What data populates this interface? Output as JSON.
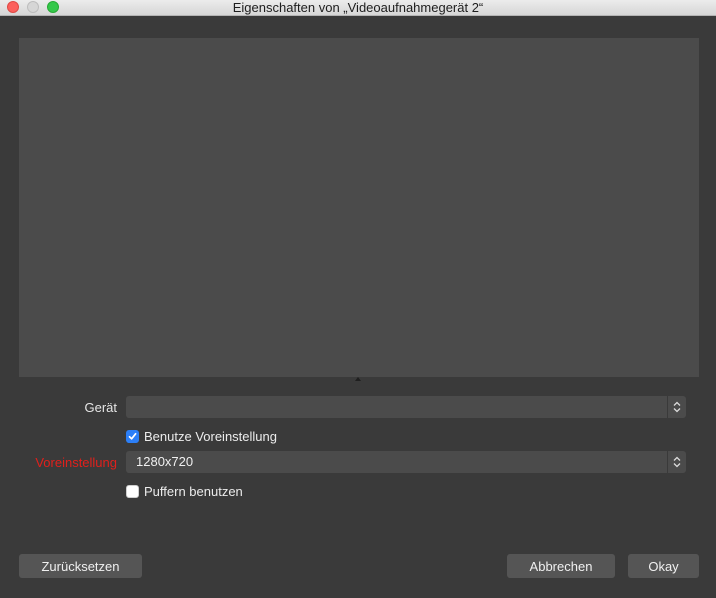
{
  "window": {
    "title": "Eigenschaften von „Videoaufnahmegerät 2“"
  },
  "form": {
    "device": {
      "label": "Gerät",
      "value": ""
    },
    "use_preset": {
      "label": "Benutze Voreinstellung",
      "checked": true
    },
    "preset": {
      "label": "Voreinstellung",
      "value": "1280x720",
      "label_color": "#e0201c"
    },
    "buffering": {
      "label": "Puffern benutzen",
      "checked": false
    }
  },
  "buttons": {
    "reset": "Zurücksetzen",
    "cancel": "Abbrechen",
    "ok": "Okay"
  },
  "icons": {
    "close": "close-icon",
    "minimize": "minimize-icon",
    "maximize": "maximize-icon",
    "combo_arrows": "chevron-up-down-icon",
    "check": "checkmark-icon"
  },
  "colors": {
    "accent": "#2c7ff7",
    "background": "#3a3a3a",
    "preview": "#4b4b4b"
  }
}
